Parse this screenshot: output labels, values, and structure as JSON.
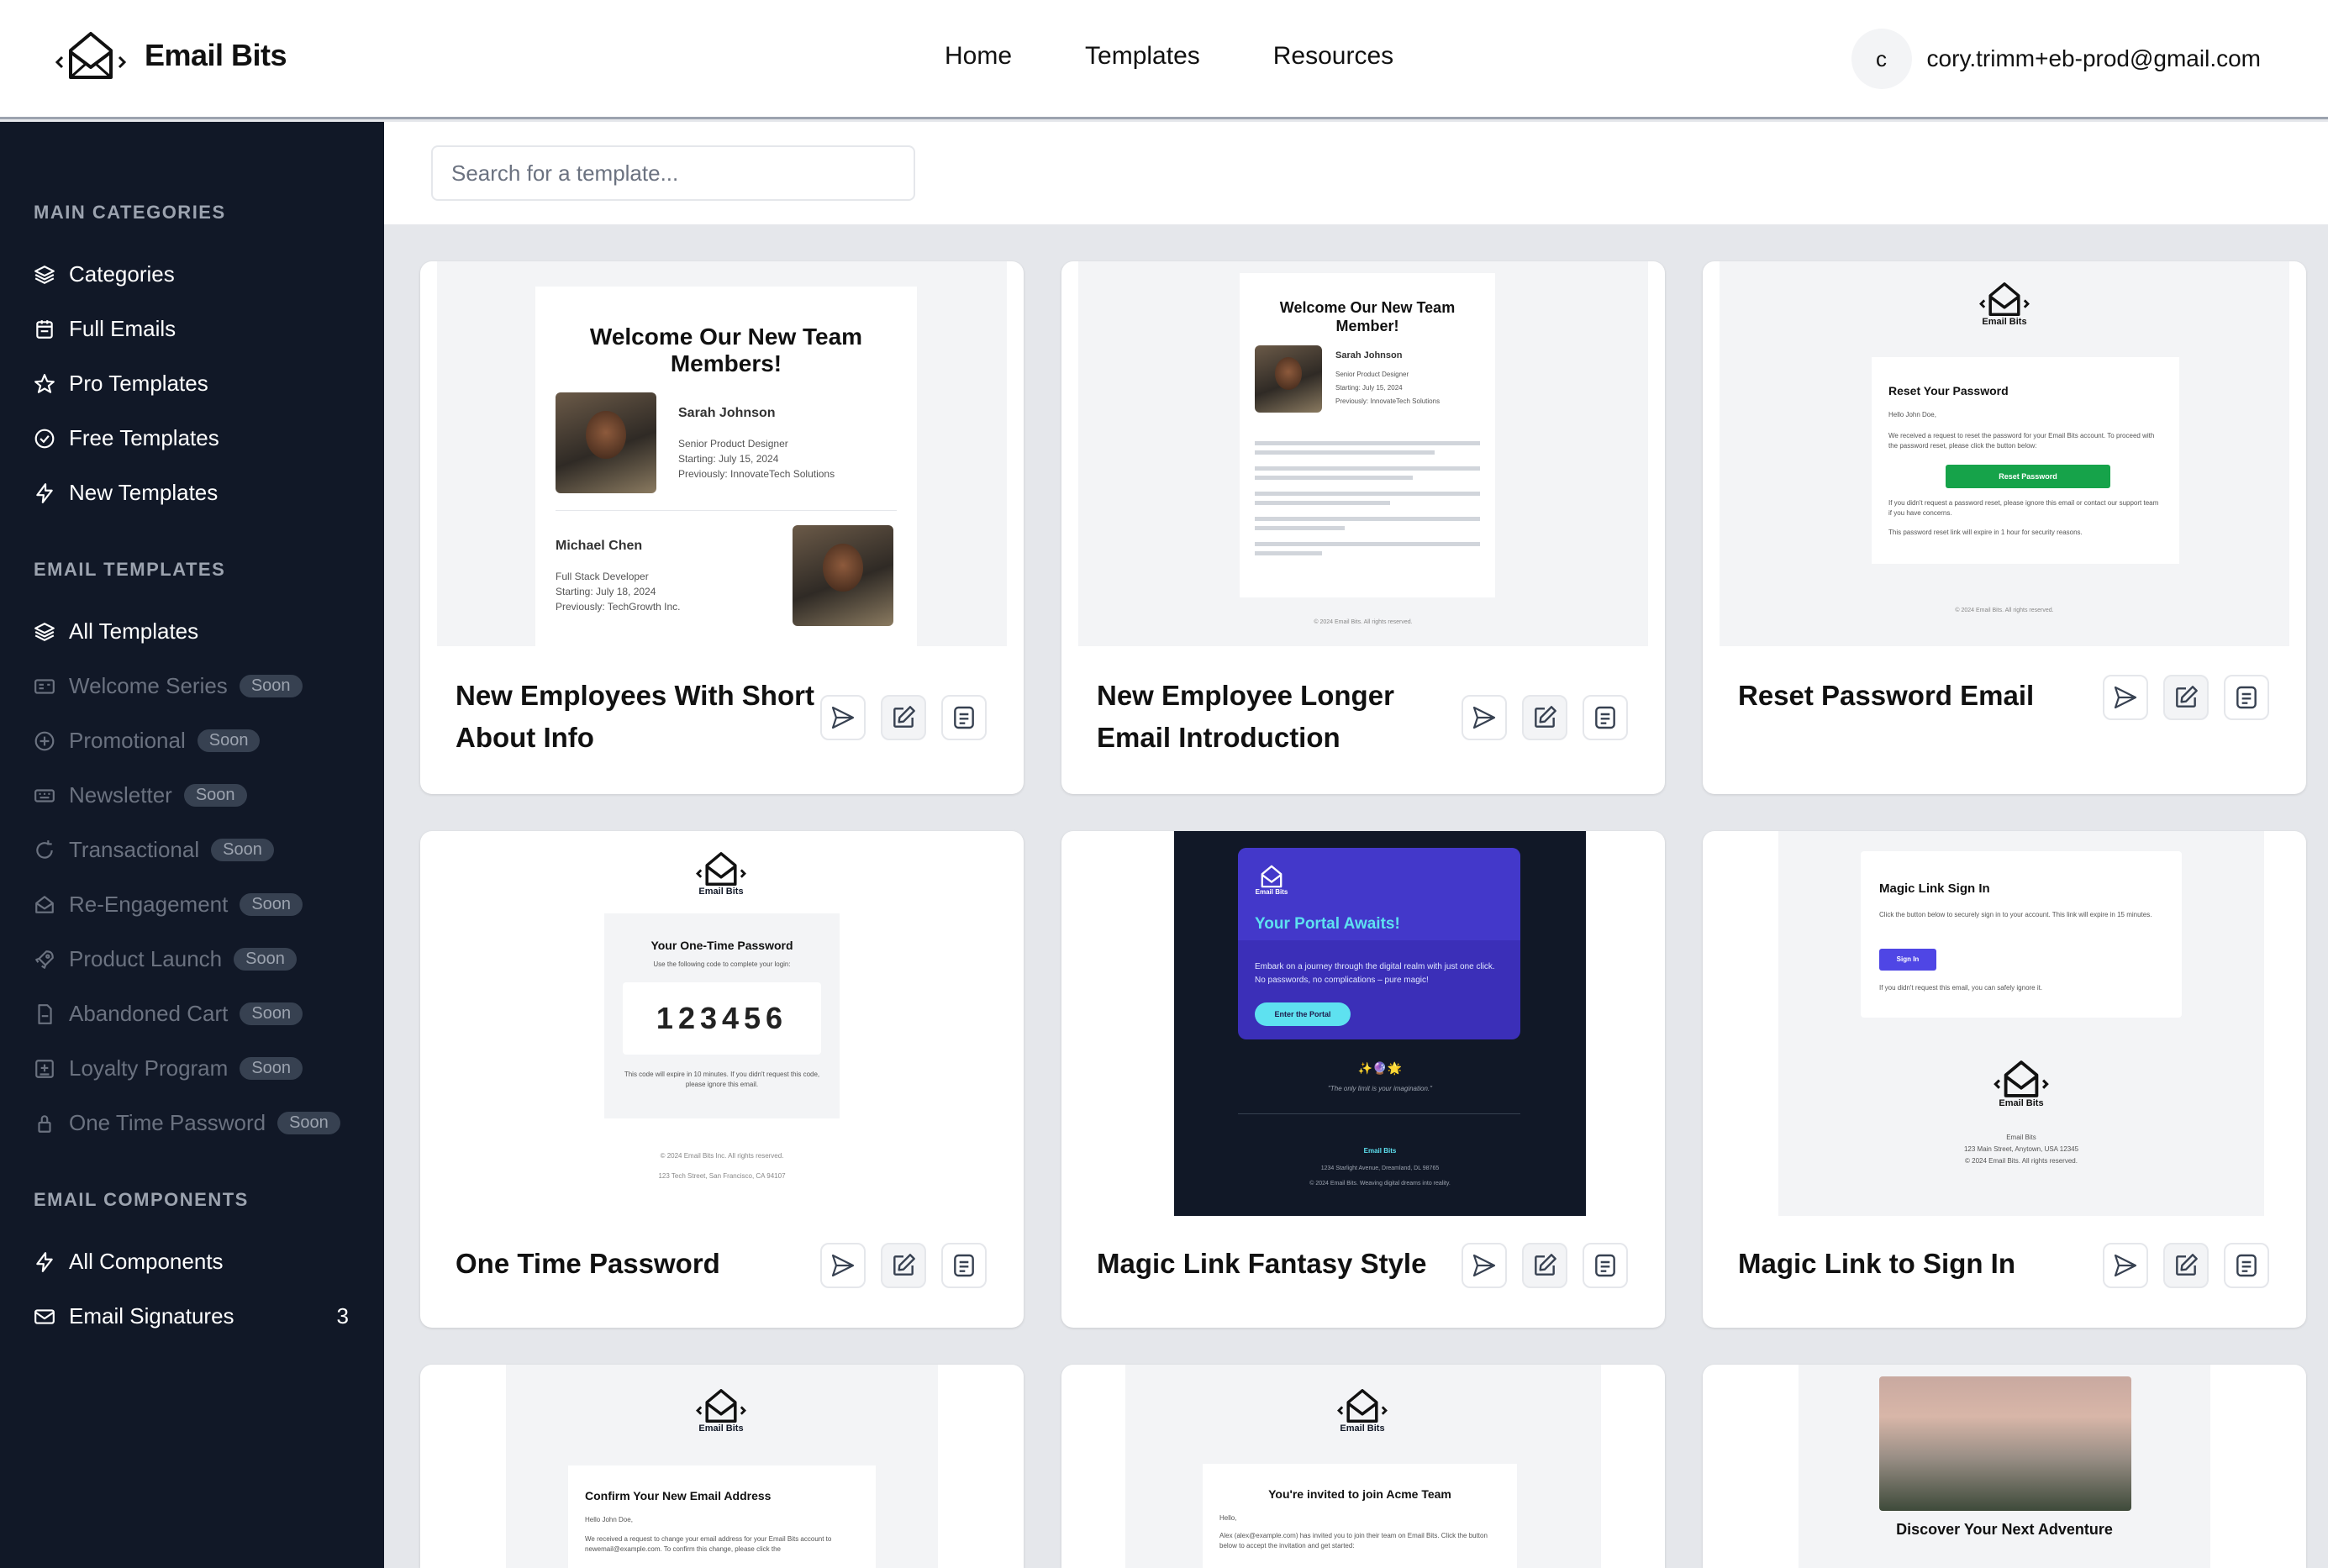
{
  "header": {
    "brand": "Email Bits",
    "nav": [
      "Home",
      "Templates",
      "Resources"
    ],
    "user_initial": "c",
    "user_email": "cory.trimm+eb-prod@gmail.com"
  },
  "search": {
    "placeholder": "Search for a template..."
  },
  "sidebar": {
    "main_heading": "MAIN CATEGORIES",
    "main_items": [
      {
        "label": "Categories",
        "icon": "layers-icon"
      },
      {
        "label": "Full Emails",
        "icon": "calendar-icon"
      },
      {
        "label": "Pro Templates",
        "icon": "star-icon"
      },
      {
        "label": "Free Templates",
        "icon": "check-circle-icon"
      },
      {
        "label": "New Templates",
        "icon": "bolt-icon"
      }
    ],
    "templates_heading": "EMAIL TEMPLATES",
    "all_templates": "All Templates",
    "soon_label": "Soon",
    "soon_items": [
      "Welcome Series",
      "Promotional",
      "Newsletter",
      "Transactional",
      "Re-Engagement",
      "Product Launch",
      "Abandoned Cart",
      "Loyalty Program",
      "One Time Password"
    ],
    "components_heading": "EMAIL COMPONENTS",
    "all_components": "All Components",
    "email_signatures": "Email Signatures",
    "email_signatures_count": "3"
  },
  "cards": [
    {
      "title": "New Employees With Short About Info"
    },
    {
      "title": "New Employee Longer Email Introduction"
    },
    {
      "title": "Reset Password Email"
    },
    {
      "title": "One Time Password"
    },
    {
      "title": "Magic Link Fantasy Style"
    },
    {
      "title": "Magic Link to Sign In"
    }
  ],
  "previews": {
    "p1": {
      "heading": "Welcome Our New Team Members!",
      "name1": "Sarah Johnson",
      "role1": "Senior Product Designer",
      "start1": "Starting: July 15, 2024",
      "prev1": "Previously: InnovateTech Solutions",
      "name2": "Michael Chen",
      "role2": "Full Stack Developer",
      "start2": "Starting: July 18, 2024",
      "prev2": "Previously: TechGrowth Inc."
    },
    "p2": {
      "heading": "Welcome Our New Team Member!",
      "name": "Sarah Johnson",
      "role": "Senior Product Designer",
      "start": "Starting: July 15, 2024",
      "prev": "Previously: InnovateTech Solutions",
      "footer": "© 2024 Email Bits. All rights reserved."
    },
    "p3": {
      "brand": "Email Bits",
      "heading": "Reset Your Password",
      "hello": "Hello John Doe,",
      "body": "We received a request to reset the password for your Email Bits account. To proceed with the password reset, please click the button below:",
      "button": "Reset Password",
      "note": "If you didn't request a password reset, please ignore this email or contact our support team if you have concerns.",
      "expire": "This password reset link will expire in 1 hour for security reasons.",
      "footer": "© 2024 Email Bits. All rights reserved."
    },
    "p4": {
      "brand": "Email Bits",
      "heading": "Your One-Time Password",
      "sub": "Use the following code to complete your login:",
      "code": "123456",
      "note": "This code will expire in 10 minutes. If you didn't request this code, please ignore this email.",
      "footer1": "© 2024 Email Bits Inc. All rights reserved.",
      "footer2": "123 Tech Street, San Francisco, CA 94107"
    },
    "p5": {
      "brand": "Email Bits",
      "heading": "Your Portal Awaits!",
      "body": "Embark on a journey through the digital realm with just one click. No passwords, no complications – pure magic!",
      "button": "Enter the Portal",
      "emoji": "✨🔮🌟",
      "quote": "\"The only limit is your imagination.\"",
      "footer_brand": "Email Bits",
      "footer_addr": "1234 Starlight Avenue, Dreamland, DL 98765",
      "footer_copy": "© 2024 Email Bits. Weaving digital dreams into reality."
    },
    "p6": {
      "heading": "Magic Link Sign In",
      "body": "Click the button below to securely sign in to your account. This link will expire in 15 minutes.",
      "button": "Sign In",
      "note": "If you didn't request this email, you can safely ignore it.",
      "brand": "Email Bits",
      "footer_brand": "Email Bits",
      "footer_addr": "123 Main Street, Anytown, USA 12345",
      "footer_copy": "© 2024 Email Bits. All rights reserved."
    },
    "p7": {
      "brand": "Email Bits",
      "heading": "Confirm Your New Email Address",
      "hello": "Hello John Doe,",
      "body": "We received a request to change your email address for your Email Bits account to newemail@example.com. To confirm this change, please click the"
    },
    "p8": {
      "brand": "Email Bits",
      "heading": "You're invited to join Acme Team",
      "hello": "Hello,",
      "body": "Alex (alex@example.com) has invited you to join their team on Email Bits. Click the button below to accept the invitation and get started:"
    },
    "p9": {
      "heading": "Discover Your Next Adventure"
    }
  },
  "colors": {
    "sidebar_bg": "#111827",
    "accent_green": "#16a34a",
    "accent_indigo": "#4f46e5",
    "portal_purple": "#3b2fb8",
    "cyan": "#5ee1f0"
  }
}
